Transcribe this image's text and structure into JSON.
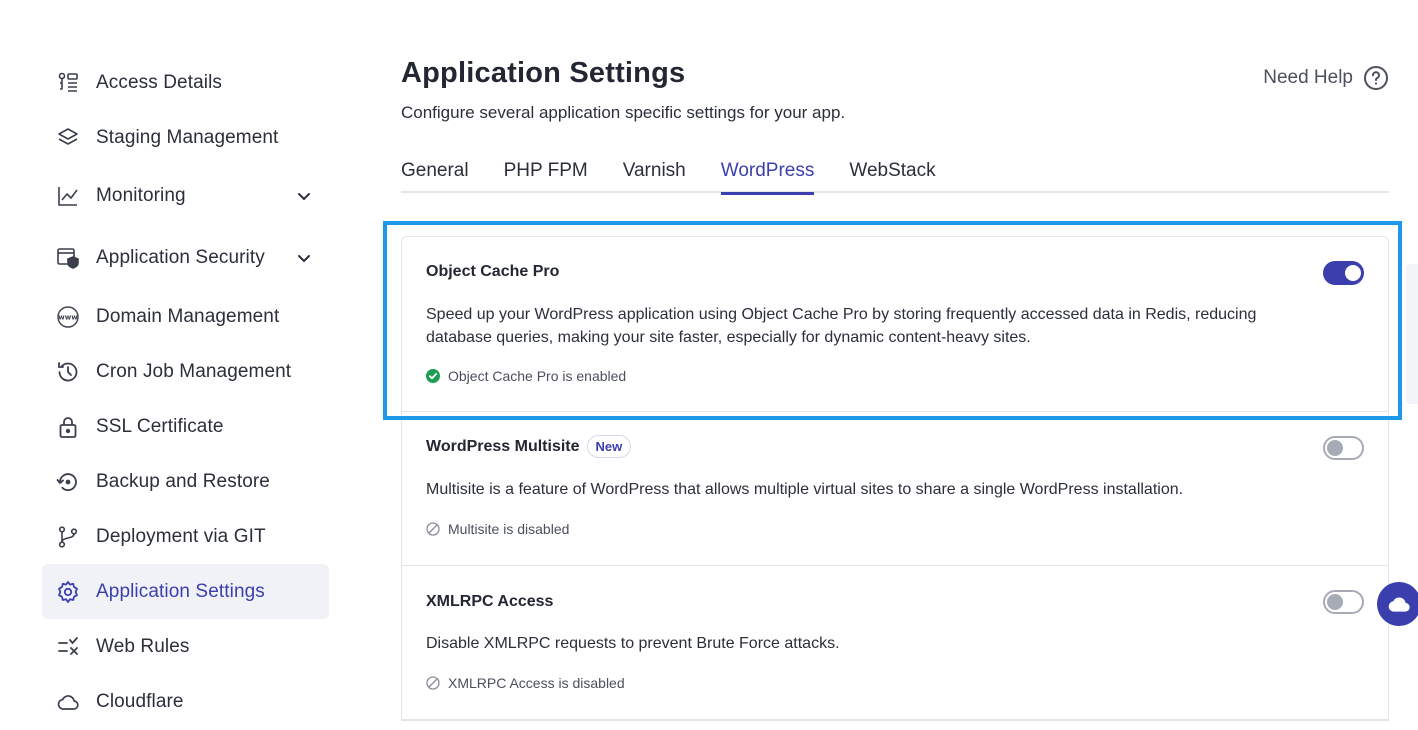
{
  "sidebar": {
    "items": [
      {
        "label": "Access Details",
        "icon": "access-details-icon"
      },
      {
        "label": "Staging Management",
        "icon": "layers-icon"
      },
      {
        "label": "Monitoring",
        "icon": "chart-line-icon"
      },
      {
        "label": "Application Security",
        "icon": "app-security-icon"
      },
      {
        "label": "Domain Management",
        "icon": "www-icon"
      },
      {
        "label": "Cron Job Management",
        "icon": "history-icon"
      },
      {
        "label": "SSL Certificate",
        "icon": "lock-icon"
      },
      {
        "label": "Backup and Restore",
        "icon": "backup-restore-icon"
      },
      {
        "label": "Deployment via GIT",
        "icon": "git-branch-icon"
      },
      {
        "label": "Application Settings",
        "icon": "gear-icon"
      },
      {
        "label": "Web Rules",
        "icon": "web-rules-icon"
      },
      {
        "label": "Cloudflare",
        "icon": "cloud-icon"
      }
    ]
  },
  "header": {
    "title": "Application Settings",
    "subtitle": "Configure several application specific settings for your app.",
    "help_label": "Need Help"
  },
  "tabs": [
    "General",
    "PHP FPM",
    "Varnish",
    "WordPress",
    "WebStack"
  ],
  "active_tab": "WordPress",
  "cards": [
    {
      "title": "Object Cache Pro",
      "description": "Speed up your WordPress application using Object Cache Pro by storing frequently accessed data in Redis, reducing database queries, making your site faster, especially for dynamic content-heavy sites.",
      "status": "Object Cache Pro is enabled",
      "enabled": true
    },
    {
      "title": "WordPress Multisite",
      "badge": "New",
      "description": "Multisite is a feature of WordPress that allows multiple virtual sites to share a single WordPress installation.",
      "status": "Multisite is disabled",
      "enabled": false
    },
    {
      "title": "XMLRPC Access",
      "description": "Disable XMLRPC requests to prevent Brute Force attacks.",
      "status": "XMLRPC Access is disabled",
      "enabled": false
    }
  ],
  "colors": {
    "accent": "#3b3fae",
    "highlight": "#1e98e8",
    "success": "#1f9d55"
  }
}
